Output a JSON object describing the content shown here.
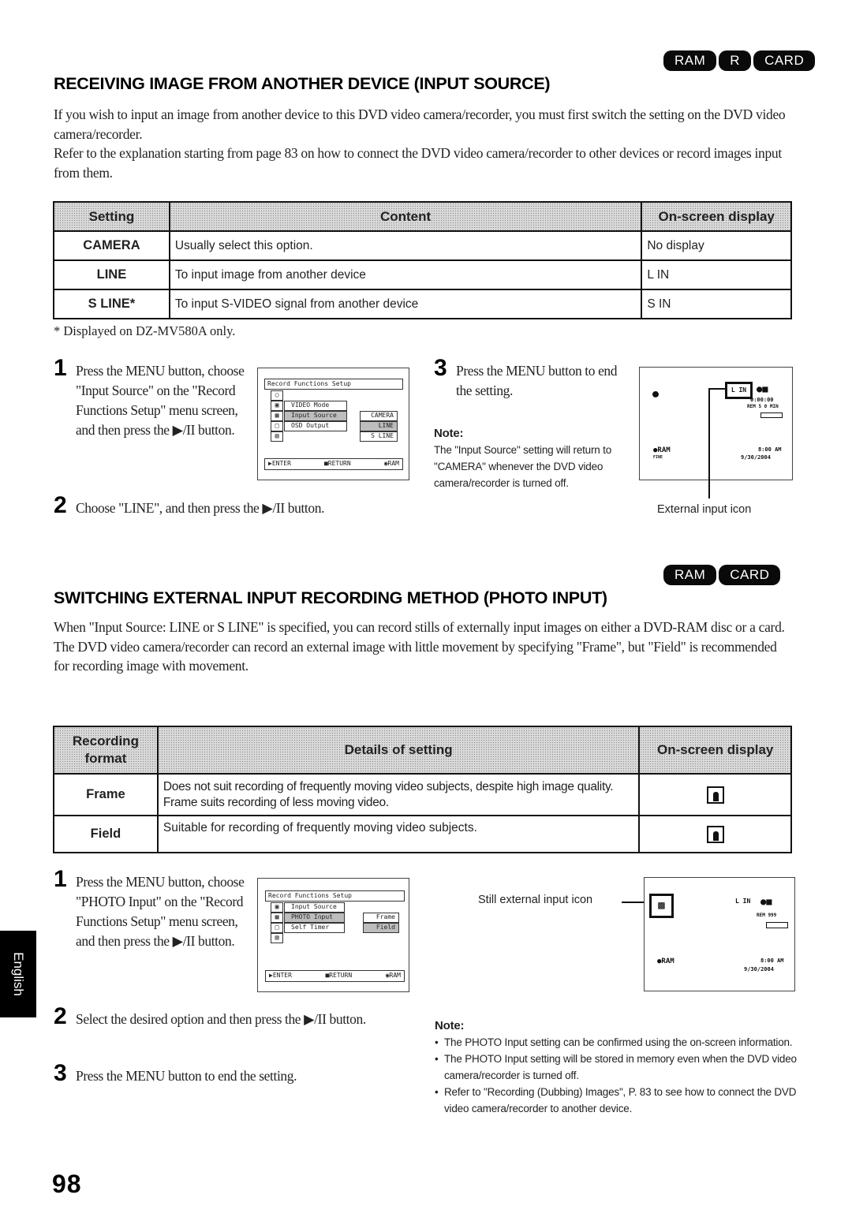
{
  "section1": {
    "badges": [
      "RAM",
      "R",
      "CARD"
    ],
    "title": "RECEIVING IMAGE FROM ANOTHER DEVICE (INPUT SOURCE)",
    "paragraphs": [
      "If you wish to input an image from another device to this DVD video camera/recorder, you must first switch the setting on the DVD video camera/recorder.",
      "Refer to the explanation starting from page 83 on how to connect the DVD video camera/recorder to other devices or record images input from them."
    ],
    "table": {
      "headers": [
        "Setting",
        "Content",
        "On-screen display"
      ],
      "rows": [
        {
          "setting": "CAMERA",
          "content": "Usually select this option.",
          "display": "No display"
        },
        {
          "setting": "LINE",
          "content": "To input image from another device",
          "display": "L IN"
        },
        {
          "setting": "S LINE*",
          "content": "To input S-VIDEO signal from another device",
          "display": "S IN"
        }
      ]
    },
    "footnote": "* Displayed on DZ-MV580A only.",
    "steps": [
      {
        "num": "1",
        "text": "Press the MENU button, choose \"Input Source\" on the \"Record Functions Setup\" menu screen, and then press the ▶/II button."
      },
      {
        "num": "2",
        "text": "Choose \"LINE\", and then press the ▶/II button."
      },
      {
        "num": "3",
        "text": "Press the MENU button to end the setting."
      }
    ],
    "menu": {
      "title": "Record Functions Setup",
      "items": [
        "VIDEO Mode",
        "Input Source",
        "OSD Output"
      ],
      "options": [
        "CAMERA",
        "LINE",
        "S LINE"
      ],
      "footer": [
        "ENTER",
        "RETURN",
        "RAM"
      ]
    },
    "note": {
      "title": "Note:",
      "text": "The \"Input Source\" setting will return to \"CAMERA\" whenever the DVD video camera/recorder is turned off."
    },
    "viewfinder": {
      "input_label": "L IN",
      "counter": "0:00:00",
      "remain": "REM 5 0 MIN",
      "disc": "RAM",
      "mode": "FINE",
      "time": "8:00 AM",
      "date": "9/30/2004"
    },
    "callout": "External input icon"
  },
  "section2": {
    "badges": [
      "RAM",
      "CARD"
    ],
    "title": "SWITCHING EXTERNAL INPUT RECORDING METHOD (PHOTO INPUT)",
    "paragraph": "When \"Input Source: LINE or S LINE\" is specified, you can record stills of externally input images on either a DVD-RAM disc or a card. The DVD video camera/recorder can record an external image with little movement by specifying \"Frame\", but \"Field\" is recommended for recording image with movement.",
    "table": {
      "headers": [
        "Recording format",
        "Details of setting",
        "On-screen display"
      ],
      "rows": [
        {
          "format": "Frame",
          "details": "Does not suit recording of frequently moving video subjects, despite high image quality. Frame suits recording of less moving video.",
          "display_icon": "frame-icon"
        },
        {
          "format": "Field",
          "details": "Suitable for recording of frequently moving video subjects.",
          "display_icon": "field-icon"
        }
      ]
    },
    "steps": [
      {
        "num": "1",
        "text": "Press the MENU button, choose \"PHOTO Input\" on the \"Record Functions Setup\" menu screen, and then press the ▶/II button."
      },
      {
        "num": "2",
        "text": "Select the desired option and then press the ▶/II button."
      },
      {
        "num": "3",
        "text": "Press the MENU button to end the setting."
      }
    ],
    "menu": {
      "title": "Record Functions Setup",
      "items": [
        "Input Source",
        "PHOTO Input",
        "Self Timer"
      ],
      "options": [
        "Frame",
        "Field"
      ],
      "footer": [
        "ENTER",
        "RETURN",
        "RAM"
      ]
    },
    "callout": "Still external input icon",
    "viewfinder": {
      "input_label": "L IN",
      "remain": "REM 999",
      "disc": "RAM",
      "time": "8:00 AM",
      "date": "9/30/2004"
    },
    "note": {
      "title": "Note:",
      "items": [
        "The PHOTO Input setting can be confirmed using the on-screen information.",
        "The PHOTO Input setting will be stored in memory even when the DVD video camera/recorder is turned off.",
        "Refer to \"Recording (Dubbing) Images\", P. 83 to see how to connect the DVD video camera/recorder to another device."
      ]
    }
  },
  "side_tab": "English",
  "page_number": "98"
}
